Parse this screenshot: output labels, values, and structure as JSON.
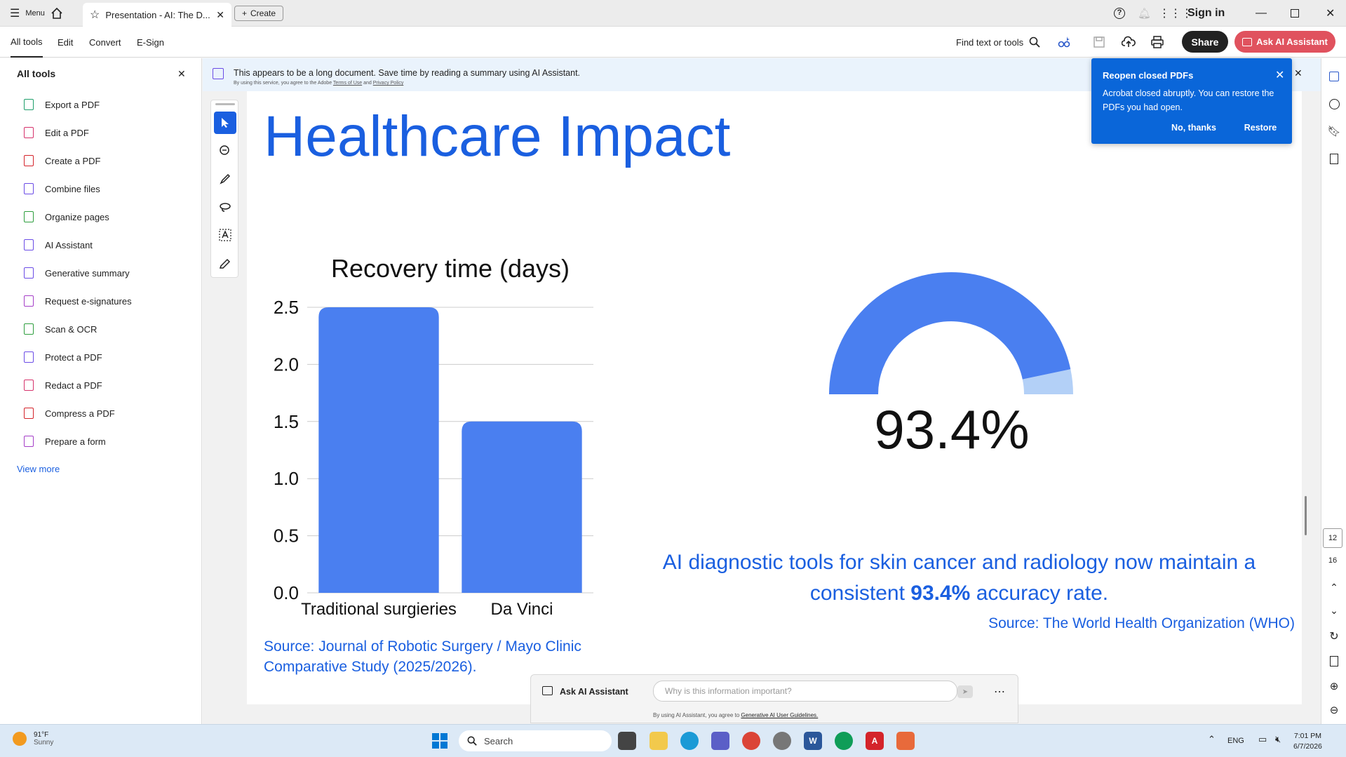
{
  "titlebar": {
    "menu_label": "Menu",
    "tab_title": "Presentation - AI: The D...",
    "create_label": "Create",
    "sign_in": "Sign in"
  },
  "toolbar": {
    "tabs": [
      "All tools",
      "Edit",
      "Convert",
      "E-Sign"
    ],
    "find_label": "Find text or tools",
    "share_label": "Share",
    "ask_ai_label": "Ask AI Assistant"
  },
  "sidebar": {
    "title": "All tools",
    "items": [
      {
        "label": "Export a PDF",
        "icon": "export-pdf-icon",
        "color": "#1e9e6b"
      },
      {
        "label": "Edit a PDF",
        "icon": "edit-pdf-icon",
        "color": "#d6336c"
      },
      {
        "label": "Create a PDF",
        "icon": "create-pdf-icon",
        "color": "#d4242b"
      },
      {
        "label": "Combine files",
        "icon": "combine-files-icon",
        "color": "#6b4ce6"
      },
      {
        "label": "Organize pages",
        "icon": "organize-pages-icon",
        "color": "#2e9e3e"
      },
      {
        "label": "AI Assistant",
        "icon": "ai-assistant-icon",
        "color": "#6b4ce6"
      },
      {
        "label": "Generative summary",
        "icon": "generative-summary-icon",
        "color": "#6b4ce6"
      },
      {
        "label": "Request e-signatures",
        "icon": "request-signatures-icon",
        "color": "#a53ec8"
      },
      {
        "label": "Scan & OCR",
        "icon": "scan-ocr-icon",
        "color": "#2e9e3e"
      },
      {
        "label": "Protect a PDF",
        "icon": "protect-pdf-icon",
        "color": "#6b4ce6"
      },
      {
        "label": "Redact a PDF",
        "icon": "redact-pdf-icon",
        "color": "#d6336c"
      },
      {
        "label": "Compress a PDF",
        "icon": "compress-pdf-icon",
        "color": "#d4242b"
      },
      {
        "label": "Prepare a form",
        "icon": "prepare-form-icon",
        "color": "#a53ec8"
      }
    ],
    "view_more": "View more"
  },
  "banner": {
    "text": "This appears to be a long document. Save time by reading a summary using AI Assistant.",
    "fineprint": "By using this service, you agree to the Adobe",
    "terms_link": "Terms of Use",
    "and": "and",
    "privacy_link": "Privacy Policy"
  },
  "popup": {
    "title": "Reopen closed PDFs",
    "body": "Acrobat closed abruptly. You can restore the PDFs you had open.",
    "no_thanks": "No, thanks",
    "restore": "Restore"
  },
  "slide": {
    "title": "Healthcare Impact",
    "chart_source": "Source: Journal of Robotic Surgery / Mayo Clinic Comparative Study (2025/2026).",
    "gauge_label": "93.4%",
    "stat_text_before": "AI diagnostic tools for skin cancer and radiology now maintain a consistent",
    "stat_value": "93.4%",
    "stat_text_after": "accuracy rate.",
    "stat_source": "Source: The World Health Organization (WHO)"
  },
  "chart_data": {
    "type": "bar",
    "title": "Recovery time (days)",
    "categories": [
      "Traditional surgieries",
      "Da Vinci"
    ],
    "values": [
      2.5,
      1.5
    ],
    "ylim": [
      0,
      2.5
    ],
    "yticks": [
      "0.0",
      "0.5",
      "1.0",
      "1.5",
      "2.0",
      "2.5"
    ],
    "grid": true,
    "bar_color": "#4a7ff0"
  },
  "gauge": {
    "value": 0.934,
    "fill_color": "#4a7ff0",
    "track_color": "#b3d0f7"
  },
  "page_nav": {
    "current": "12",
    "total": "16"
  },
  "ai_bar": {
    "label": "Ask AI Assistant",
    "placeholder": "Why is this information important?",
    "fineprint": "By using AI Assistant, you agree to",
    "guidelines_link": "Generative AI User Guidelines."
  },
  "taskbar": {
    "weather_temp": "91°F",
    "weather_desc": "Sunny",
    "search_label": "Search",
    "lang": "ENG",
    "time": "7:01 PM",
    "date": "6/7/2026"
  },
  "colors": {
    "accent_blue": "#1a5fe0",
    "chart_blue": "#4a7ff0"
  }
}
